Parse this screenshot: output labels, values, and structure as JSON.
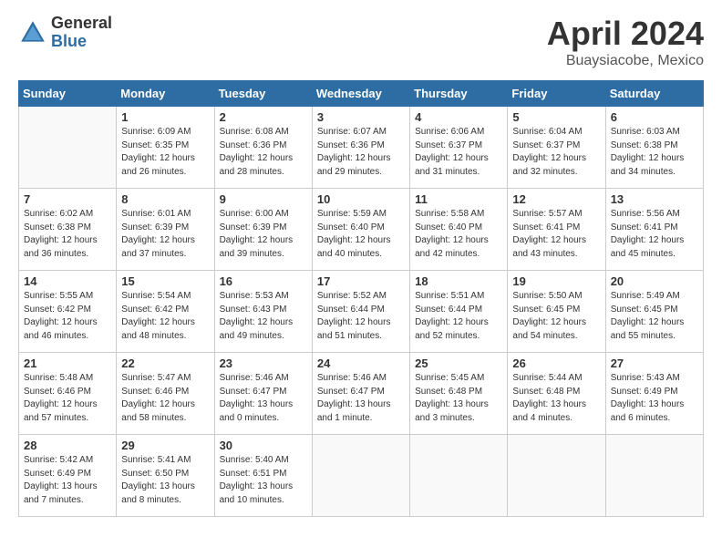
{
  "header": {
    "logo_general": "General",
    "logo_blue": "Blue",
    "main_title": "April 2024",
    "subtitle": "Buaysiacobe, Mexico"
  },
  "calendar": {
    "weekdays": [
      "Sunday",
      "Monday",
      "Tuesday",
      "Wednesday",
      "Thursday",
      "Friday",
      "Saturday"
    ],
    "weeks": [
      [
        {
          "day": null
        },
        {
          "day": "1",
          "sunrise": "6:09 AM",
          "sunset": "6:35 PM",
          "daylight": "12 hours and 26 minutes."
        },
        {
          "day": "2",
          "sunrise": "6:08 AM",
          "sunset": "6:36 PM",
          "daylight": "12 hours and 28 minutes."
        },
        {
          "day": "3",
          "sunrise": "6:07 AM",
          "sunset": "6:36 PM",
          "daylight": "12 hours and 29 minutes."
        },
        {
          "day": "4",
          "sunrise": "6:06 AM",
          "sunset": "6:37 PM",
          "daylight": "12 hours and 31 minutes."
        },
        {
          "day": "5",
          "sunrise": "6:04 AM",
          "sunset": "6:37 PM",
          "daylight": "12 hours and 32 minutes."
        },
        {
          "day": "6",
          "sunrise": "6:03 AM",
          "sunset": "6:38 PM",
          "daylight": "12 hours and 34 minutes."
        }
      ],
      [
        {
          "day": "7",
          "sunrise": "6:02 AM",
          "sunset": "6:38 PM",
          "daylight": "12 hours and 36 minutes."
        },
        {
          "day": "8",
          "sunrise": "6:01 AM",
          "sunset": "6:39 PM",
          "daylight": "12 hours and 37 minutes."
        },
        {
          "day": "9",
          "sunrise": "6:00 AM",
          "sunset": "6:39 PM",
          "daylight": "12 hours and 39 minutes."
        },
        {
          "day": "10",
          "sunrise": "5:59 AM",
          "sunset": "6:40 PM",
          "daylight": "12 hours and 40 minutes."
        },
        {
          "day": "11",
          "sunrise": "5:58 AM",
          "sunset": "6:40 PM",
          "daylight": "12 hours and 42 minutes."
        },
        {
          "day": "12",
          "sunrise": "5:57 AM",
          "sunset": "6:41 PM",
          "daylight": "12 hours and 43 minutes."
        },
        {
          "day": "13",
          "sunrise": "5:56 AM",
          "sunset": "6:41 PM",
          "daylight": "12 hours and 45 minutes."
        }
      ],
      [
        {
          "day": "14",
          "sunrise": "5:55 AM",
          "sunset": "6:42 PM",
          "daylight": "12 hours and 46 minutes."
        },
        {
          "day": "15",
          "sunrise": "5:54 AM",
          "sunset": "6:42 PM",
          "daylight": "12 hours and 48 minutes."
        },
        {
          "day": "16",
          "sunrise": "5:53 AM",
          "sunset": "6:43 PM",
          "daylight": "12 hours and 49 minutes."
        },
        {
          "day": "17",
          "sunrise": "5:52 AM",
          "sunset": "6:44 PM",
          "daylight": "12 hours and 51 minutes."
        },
        {
          "day": "18",
          "sunrise": "5:51 AM",
          "sunset": "6:44 PM",
          "daylight": "12 hours and 52 minutes."
        },
        {
          "day": "19",
          "sunrise": "5:50 AM",
          "sunset": "6:45 PM",
          "daylight": "12 hours and 54 minutes."
        },
        {
          "day": "20",
          "sunrise": "5:49 AM",
          "sunset": "6:45 PM",
          "daylight": "12 hours and 55 minutes."
        }
      ],
      [
        {
          "day": "21",
          "sunrise": "5:48 AM",
          "sunset": "6:46 PM",
          "daylight": "12 hours and 57 minutes."
        },
        {
          "day": "22",
          "sunrise": "5:47 AM",
          "sunset": "6:46 PM",
          "daylight": "12 hours and 58 minutes."
        },
        {
          "day": "23",
          "sunrise": "5:46 AM",
          "sunset": "6:47 PM",
          "daylight": "13 hours and 0 minutes."
        },
        {
          "day": "24",
          "sunrise": "5:46 AM",
          "sunset": "6:47 PM",
          "daylight": "13 hours and 1 minute."
        },
        {
          "day": "25",
          "sunrise": "5:45 AM",
          "sunset": "6:48 PM",
          "daylight": "13 hours and 3 minutes."
        },
        {
          "day": "26",
          "sunrise": "5:44 AM",
          "sunset": "6:48 PM",
          "daylight": "13 hours and 4 minutes."
        },
        {
          "day": "27",
          "sunrise": "5:43 AM",
          "sunset": "6:49 PM",
          "daylight": "13 hours and 6 minutes."
        }
      ],
      [
        {
          "day": "28",
          "sunrise": "5:42 AM",
          "sunset": "6:49 PM",
          "daylight": "13 hours and 7 minutes."
        },
        {
          "day": "29",
          "sunrise": "5:41 AM",
          "sunset": "6:50 PM",
          "daylight": "13 hours and 8 minutes."
        },
        {
          "day": "30",
          "sunrise": "5:40 AM",
          "sunset": "6:51 PM",
          "daylight": "13 hours and 10 minutes."
        },
        {
          "day": null
        },
        {
          "day": null
        },
        {
          "day": null
        },
        {
          "day": null
        }
      ]
    ]
  }
}
